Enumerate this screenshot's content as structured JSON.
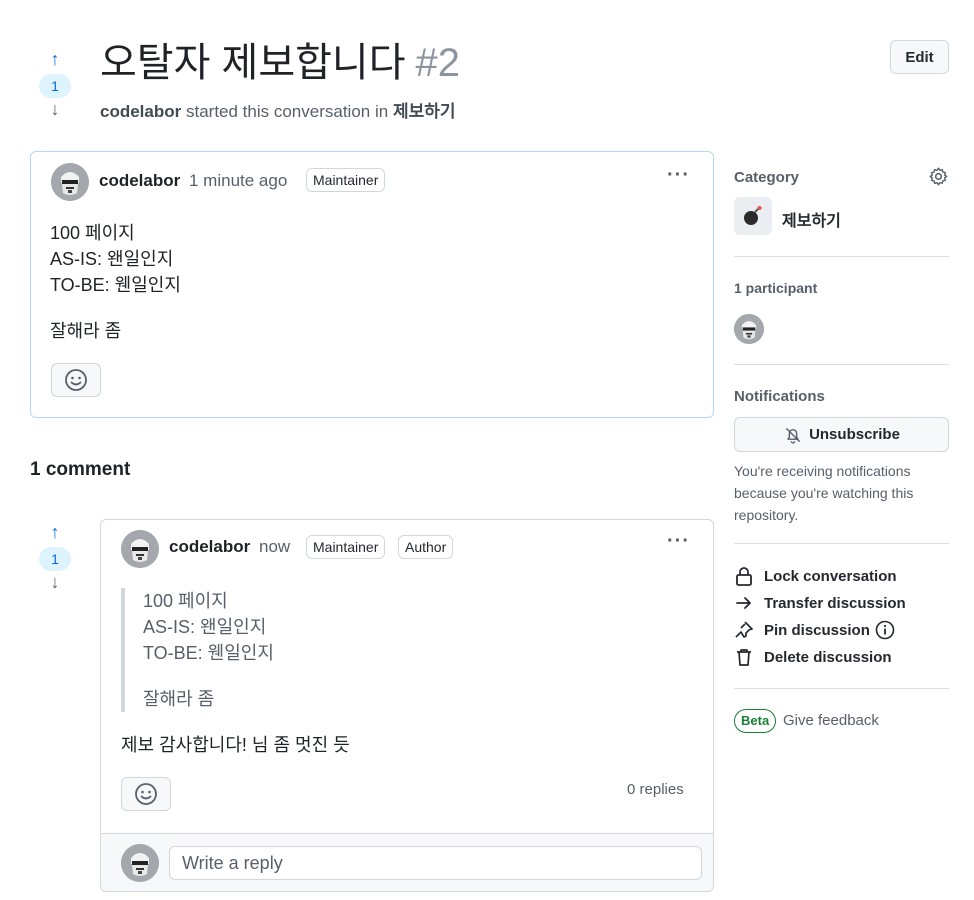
{
  "header": {
    "title": "오탈자 제보합니다",
    "number": "#2",
    "author": "codelabor",
    "started_text": "started this conversation in",
    "category": "제보하기",
    "edit_label": "Edit"
  },
  "post_vote": {
    "up": "↑",
    "count": "1",
    "down": "↓"
  },
  "post": {
    "author": "codelabor",
    "time": "1 minute ago",
    "badge": "Maintainer",
    "menu": "···",
    "lines": [
      "100 페이지",
      "AS-IS: 왠일인지",
      "TO-BE: 웬일인지"
    ],
    "closing": "잘해라 좀"
  },
  "comments_heading": "1 comment",
  "comment_vote": {
    "up": "↑",
    "count": "1",
    "down": "↓"
  },
  "comment": {
    "author": "codelabor",
    "time": "now",
    "badges": [
      "Maintainer",
      "Author"
    ],
    "menu": "···",
    "quote_lines": [
      "100 페이지",
      "AS-IS: 왠일인지",
      "TO-BE: 웬일인지"
    ],
    "quote_closing": "잘해라 좀",
    "text": "제보 감사합니다! 님 좀 멋진 듯",
    "replies": "0 replies",
    "reply_placeholder": "Write a reply"
  },
  "sidebar": {
    "category_heading": "Category",
    "category_name": "제보하기",
    "participants_heading": "1 participant",
    "notifications_heading": "Notifications",
    "unsubscribe_label": "Unsubscribe",
    "notice": "You're receiving notifications because you're watching this repository.",
    "actions": [
      {
        "label": "Lock conversation",
        "icon": "lock-icon"
      },
      {
        "label": "Transfer discussion",
        "icon": "arrow-right-icon"
      },
      {
        "label": "Pin discussion",
        "icon": "pin-icon"
      },
      {
        "label": "Delete discussion",
        "icon": "trash-icon"
      }
    ],
    "beta_label": "Beta",
    "feedback_label": "Give feedback"
  },
  "colors": {
    "accent": "#0969da",
    "border_blue": "#b6d7f5",
    "muted": "#57606a",
    "success": "#1a7f37"
  }
}
